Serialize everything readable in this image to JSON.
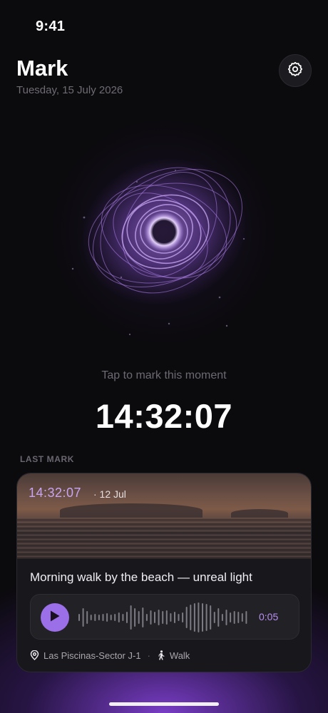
{
  "status_bar": {
    "time": "9:41"
  },
  "header": {
    "title": "Mark",
    "date": "Tuesday, 15 July 2026",
    "settings_icon": "gear-icon"
  },
  "mark_area": {
    "hint": "Tap to mark this moment",
    "current_time": "14:32:07",
    "accent_color": "#9b6fe8"
  },
  "last_mark": {
    "section_label": "LAST MARK",
    "time": "14:32:07",
    "date": "· 12 Jul",
    "note": "Morning walk by the beach — unreal light",
    "audio": {
      "play_icon": "play-icon",
      "duration": "0:05"
    },
    "location": "Las Piscinas-Sector J-1",
    "separator": "·",
    "activity": "Walk",
    "location_icon": "location-pin-icon",
    "activity_icon": "walking-person-icon"
  }
}
